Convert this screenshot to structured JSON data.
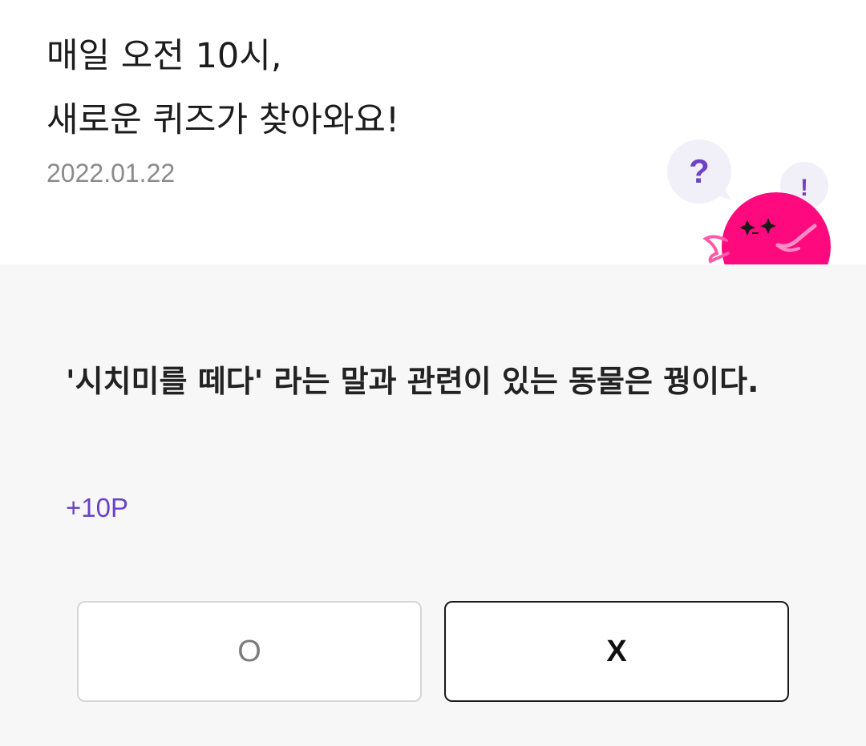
{
  "header": {
    "title_line1": "매일 오전 10시,",
    "title_line2": "새로운 퀴즈가 찾아와요!",
    "date": "2022.01.22"
  },
  "mascot": {
    "question_mark": "?",
    "exclaim_mark": "!",
    "colors": {
      "body": "#ff0a7e",
      "bubble": "#f1eff8",
      "mark": "#7040c8"
    }
  },
  "quiz": {
    "question": "'시치미를 떼다' 라는 말과 관련이 있는 동물은 꿩이다.",
    "points": "+10P",
    "answer_o": "O",
    "answer_x": "X"
  },
  "colors": {
    "accent": "#6a43c8",
    "content_bg": "#f7f7f7"
  }
}
